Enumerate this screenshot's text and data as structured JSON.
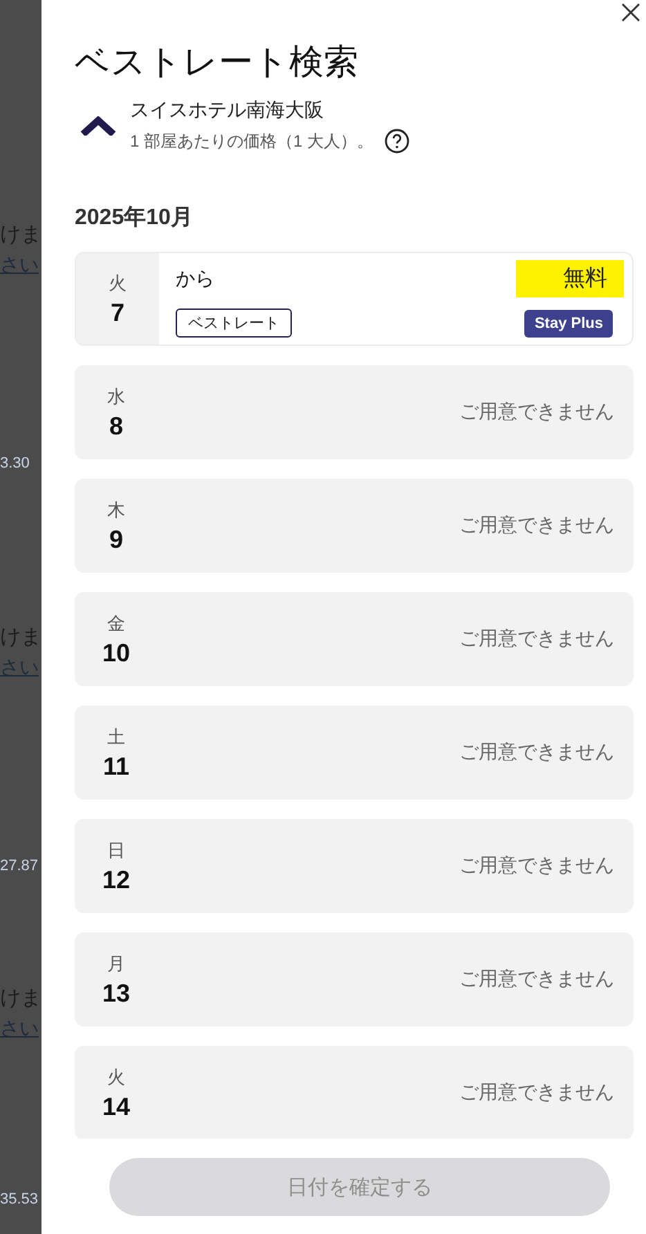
{
  "background_page": [
    {
      "kind": "text",
      "text": "けま"
    },
    {
      "kind": "link",
      "text": "さい"
    },
    {
      "kind": "number",
      "text": "3.30"
    },
    {
      "kind": "text",
      "text": "けま"
    },
    {
      "kind": "link",
      "text": "さい"
    },
    {
      "kind": "number",
      "text": "27.87"
    },
    {
      "kind": "text",
      "text": "けま"
    },
    {
      "kind": "link",
      "text": "さい"
    },
    {
      "kind": "number",
      "text": "35.53"
    }
  ],
  "panel": {
    "title": "ベストレート検索",
    "hotel_name": "スイスホテル南海大阪",
    "price_note": "1 部屋あたりの価格（1 大人）。"
  },
  "months": [
    {
      "label": "2025年10月"
    }
  ],
  "days": [
    {
      "weekday": "火",
      "day": "7",
      "kind": "available",
      "from_label": "から",
      "price": "無料",
      "highlighted": true,
      "rate_tag": "ベストレート",
      "program_badge": "Stay Plus"
    },
    {
      "weekday": "水",
      "day": "8",
      "kind": "unavailable",
      "status": "ご用意できません"
    },
    {
      "weekday": "木",
      "day": "9",
      "kind": "unavailable",
      "status": "ご用意できません"
    },
    {
      "weekday": "金",
      "day": "10",
      "kind": "unavailable",
      "status": "ご用意できません"
    },
    {
      "weekday": "土",
      "day": "11",
      "kind": "unavailable",
      "status": "ご用意できません"
    },
    {
      "weekday": "日",
      "day": "12",
      "kind": "unavailable",
      "status": "ご用意できません"
    },
    {
      "weekday": "月",
      "day": "13",
      "kind": "unavailable",
      "status": "ご用意できません"
    },
    {
      "weekday": "火",
      "day": "14",
      "kind": "unavailable",
      "status": "ご用意できません"
    }
  ],
  "confirm_button": {
    "label": "日付を確定する",
    "disabled": true
  }
}
